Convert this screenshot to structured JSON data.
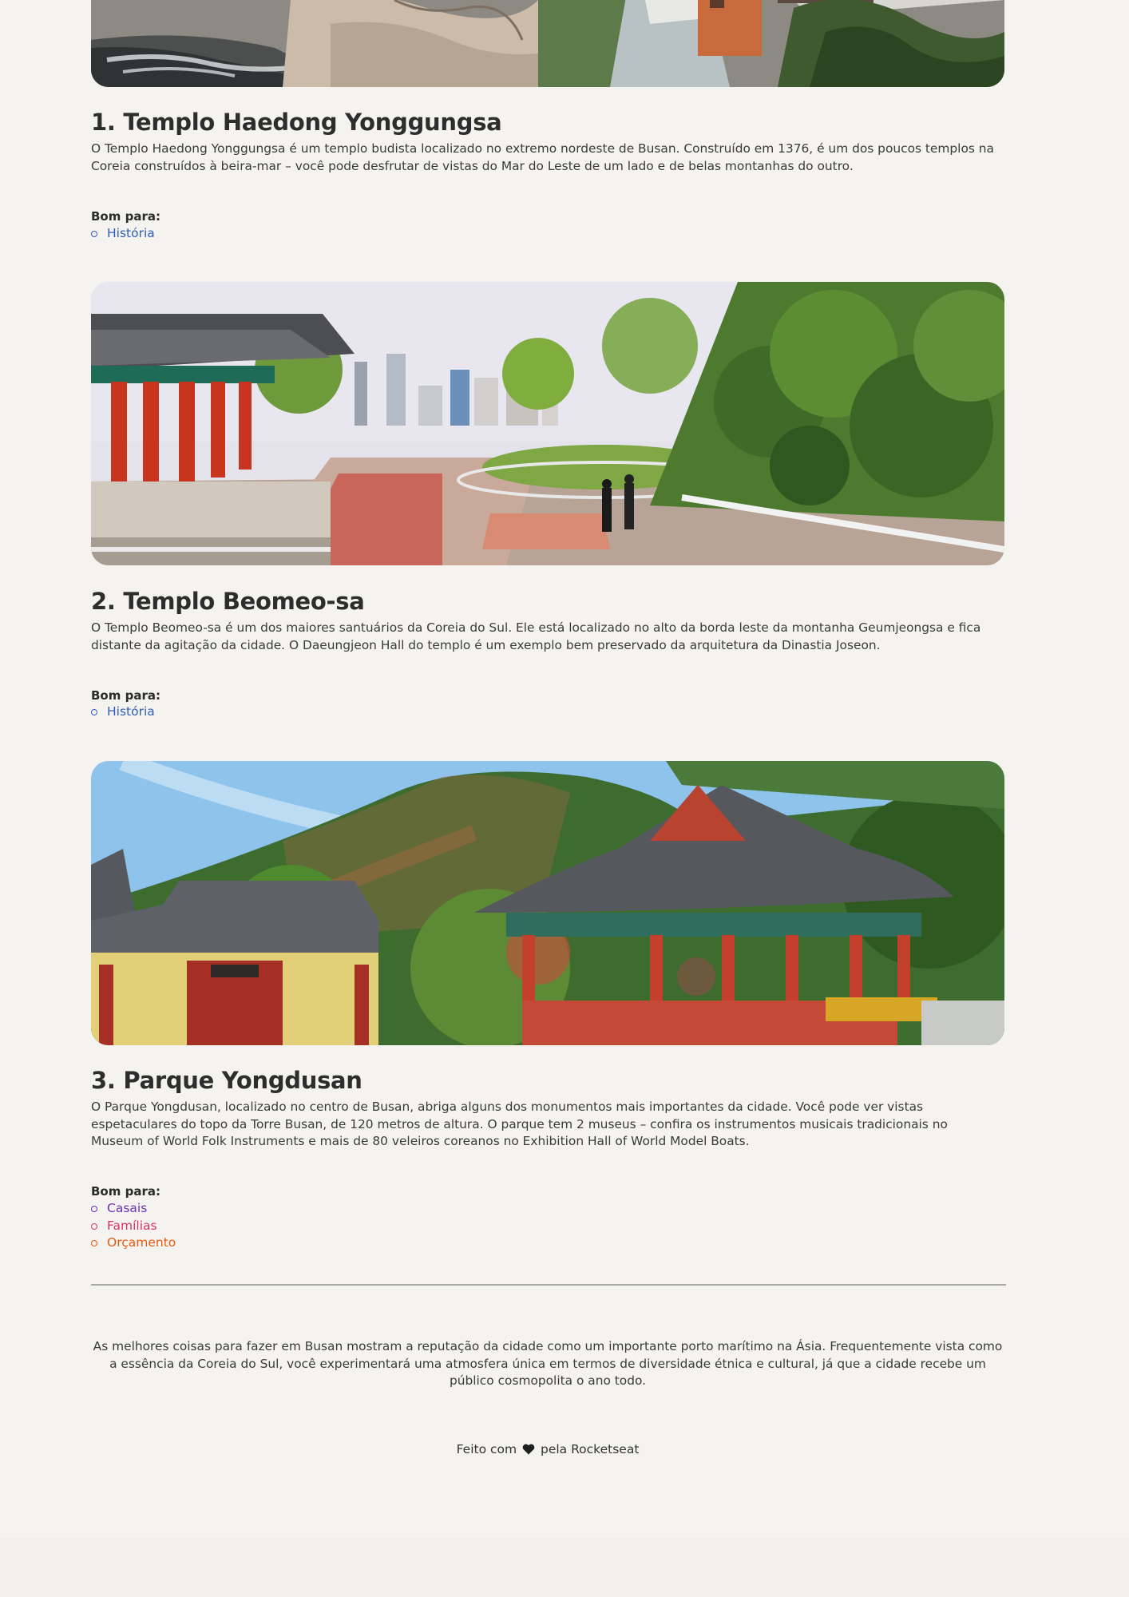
{
  "attractions": [
    {
      "title": "1. Templo Haedong Yonggungsa",
      "description": "O Templo Haedong Yonggungsa é um templo budista localizado no extremo nordeste de Busan. Construído em 1376, é um dos poucos templos na Coreia construídos à beira-mar – você pode desfrutar de vistas do Mar do Leste de um lado e de belas montanhas do outro.",
      "good_for_label": "Bom para:",
      "tags": [
        {
          "label": "História",
          "color": "#2f5dbb"
        }
      ]
    },
    {
      "title": "2. Templo Beomeo-sa",
      "description": "O Templo Beomeo-sa é um dos maiores santuários da Coreia do Sul. Ele está localizado no alto da borda leste da montanha Geumjeongsa e fica distante da agitação da cidade. O Daeungjeon Hall do templo é um exemplo bem preservado da arquitetura da Dinastia Joseon.",
      "good_for_label": "Bom para:",
      "tags": [
        {
          "label": "História",
          "color": "#2f5dbb"
        }
      ]
    },
    {
      "title": "3. Parque Yongdusan",
      "description": "O Parque Yongdusan, localizado no centro de Busan, abriga alguns dos monumentos mais importantes da cidade. Você pode ver vistas espetaculares do topo da Torre Busan, de 120 metros de altura. O parque tem 2 museus – confira os instrumentos musicais tradicionais no Museum of World Folk Instruments e mais de 80 veleiros coreanos no Exhibition Hall of World Model Boats.",
      "good_for_label": "Bom para:",
      "tags": [
        {
          "label": "Casais",
          "color": "#6f2fb8"
        },
        {
          "label": "Famílias",
          "color": "#d6336c"
        },
        {
          "label": "Orçamento",
          "color": "#e8590c"
        }
      ]
    }
  ],
  "closing_text": "As melhores coisas para fazer em Busan mostram a reputação da cidade como um importante porto marítimo na Ásia. Frequentemente vista como a essência da Coreia do Sul, você experimentará uma atmosfera única em termos de diversidade étnica e cultural, já que a cidade recebe um público cosmopolita o ano todo.",
  "footer": {
    "prefix": "Feito com",
    "icon": "heart-icon",
    "suffix": "pela Rocketseat"
  }
}
